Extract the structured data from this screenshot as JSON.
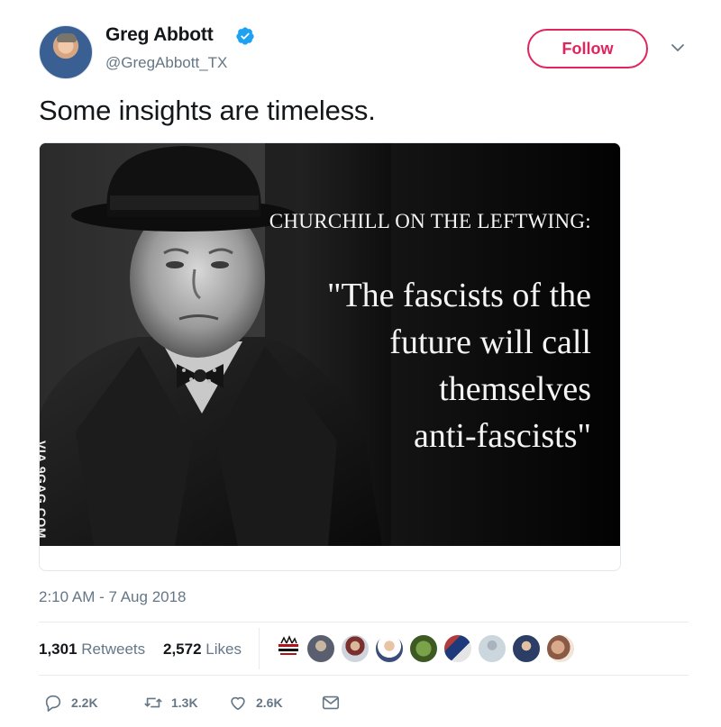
{
  "tweet": {
    "author": {
      "display_name": "Greg Abbott",
      "handle": "@GregAbbott_TX",
      "verified": true
    },
    "follow_label": "Follow",
    "text": "Some insights are timeless.",
    "media": {
      "watermark": "VIA 9GAG.COM",
      "heading": "CHURCHILL ON THE LEFTWING:",
      "quote_lines": [
        "\"The fascists of the",
        "future will call",
        "themselves",
        "anti-fascists\""
      ]
    },
    "timestamp": "2:10 AM - 7 Aug 2018",
    "stats": {
      "retweets_count": "1,301",
      "retweets_label": "Retweets",
      "likes_count": "2,572",
      "likes_label": "Likes"
    },
    "actions": {
      "replies": "2.2K",
      "retweets": "1.3K",
      "likes": "2.6K"
    }
  },
  "colors": {
    "accent_follow": "#e0245e",
    "verified_blue": "#1da1f2",
    "secondary_text": "#657786"
  },
  "icons": [
    "verified-badge-icon",
    "chevron-down-icon",
    "reply-icon",
    "retweet-icon",
    "heart-icon",
    "direct-message-icon"
  ]
}
